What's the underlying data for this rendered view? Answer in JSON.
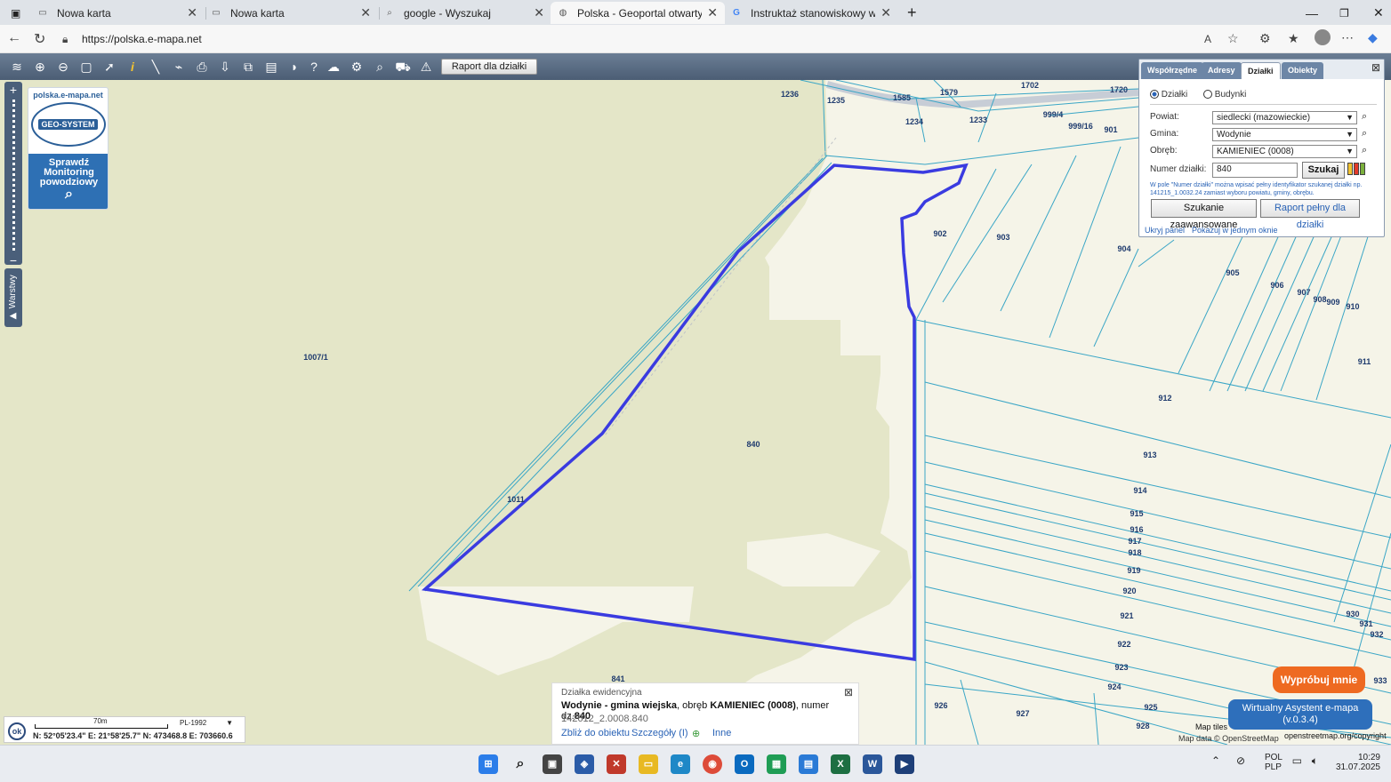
{
  "browser": {
    "tabs": [
      {
        "title": "Nowa karta",
        "icon": "page-icon"
      },
      {
        "title": "Nowa karta",
        "icon": "page-icon"
      },
      {
        "title": "google - Wyszukaj",
        "icon": "search-icon"
      },
      {
        "title": "Polska - Geoportal otwartych dan",
        "icon": "globe-icon"
      },
      {
        "title": "Instruktaż stanowiskowy wzór PD",
        "icon": "google-icon"
      }
    ],
    "url": "https://polska.e-mapa.net"
  },
  "toolbar": {
    "report_button": "Raport dla działki"
  },
  "logo": {
    "site": "polska.e-mapa.net",
    "brand": "GEO-SYSTEM",
    "flood_line1": "Sprawdź",
    "flood_line2": "Monitoring",
    "flood_line3": "powodziowy"
  },
  "side": {
    "layers_label": "▶ Warstwy"
  },
  "panel": {
    "tabs": [
      "Współrzędne",
      "Adresy",
      "Działki",
      "Obiekty"
    ],
    "active_tab": "Działki",
    "radio_dzialki": "Działki",
    "radio_budynki": "Budynki",
    "powiat_label": "Powiat:",
    "powiat_value": "siedlecki (mazowieckie)",
    "gmina_label": "Gmina:",
    "gmina_value": "Wodynie",
    "obreb_label": "Obręb:",
    "obreb_value": "KAMIENIEC (0008)",
    "numer_label": "Numer działki:",
    "numer_value": "840",
    "search_button": "Szukaj",
    "hint": "W pole \"Numer działki\" można wpisać pełny identyfikator szukanej działki np. 141215_1.0032.24 zamiast wyboru powiatu, gminy, obrębu.",
    "advanced_button": "Szukanie zaawansowane",
    "full_report_button": "Raport pełny dla działki",
    "hide_link": "Ukryj panel",
    "one_window_link": "Pokazuj w jednym oknie"
  },
  "parcel_labels": [
    "1236",
    "1235",
    "1585",
    "1579",
    "1234",
    "1233",
    "1702",
    "1720",
    "999/4",
    "999/16",
    "901",
    "902",
    "903",
    "904",
    "905",
    "906",
    "907",
    "908",
    "909",
    "910",
    "911",
    "912",
    "913",
    "914",
    "915",
    "916",
    "917",
    "918",
    "919",
    "920",
    "921",
    "922",
    "923",
    "924",
    "925",
    "926",
    "927",
    "928",
    "930",
    "931",
    "932",
    "933",
    "1007/1",
    "840",
    "1011",
    "841"
  ],
  "accent_color": "#3a3be0",
  "info": {
    "header": "Działka ewidencyjna",
    "title_prefix": "Wodynie - gmina wiejska",
    "title_mid": ", obręb ",
    "title_obreb": "KAMIENIEC (0008)",
    "title_num": ", numer dz.",
    "title_nr": "840",
    "identifier": "142612_2.0008.840",
    "link_zoom": "Zbliż do obiektu",
    "link_details": "Szczegóły (I)",
    "link_other": "Inne"
  },
  "scale": {
    "ok": "ok",
    "distance": "70m",
    "crs": "PL-1992",
    "coords": "N: 52°05'23.4\"  E: 21°58'25.7\"  N: 473468.8  E: 703660.6"
  },
  "promo": {
    "try_me": "Wypróbuj mnie",
    "assistant_line1": "Wirtualny Asystent e-mapa",
    "assistant_line2": "(v.0.3.4)"
  },
  "attribution": {
    "tiles": "Map tiles",
    "data": "Map data © OpenStreetMap",
    "osm": "openstreetmap.org/copyright"
  },
  "tray": {
    "lang1": "POL",
    "lang2": "PLP",
    "time": "10:29",
    "date": "31.07.2025"
  }
}
